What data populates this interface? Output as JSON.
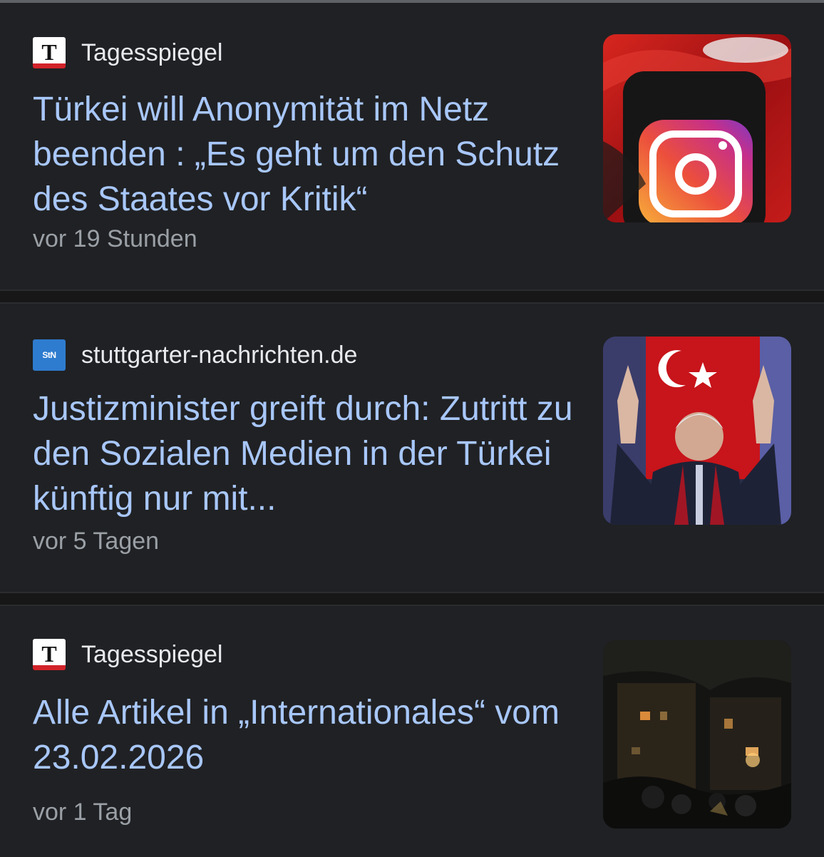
{
  "articles": [
    {
      "source": "Tagesspiegel",
      "favicon": "tagesspiegel-icon",
      "favicon_text": "T",
      "headline": "Türkei will Anonymität im Netz beenden : „Es geht um den Schutz des Staates vor Kritik“",
      "time": "vor 19 Stunden",
      "thumbnail": "instagram-logo-on-phone-with-turkish-flag-icon"
    },
    {
      "source": "stuttgarter-nachrichten.de",
      "favicon": "stuttgarter-nachrichten-icon",
      "favicon_text": "StN",
      "headline": "Justizminister greift durch: Zutritt zu den Sozialen Medien in der Türkei künftig nur mit...",
      "time": "vor 5 Tagen",
      "thumbnail": "politician-raising-hands-before-turkish-flag-icon"
    },
    {
      "source": "Tagesspiegel",
      "favicon": "tagesspiegel-icon",
      "favicon_text": "T",
      "headline": "Alle Artikel in „Internationales“ vom 23.02.2026",
      "time": "vor 1 Tag",
      "thumbnail": "night-street-scene-icon"
    }
  ],
  "colors": {
    "background": "#202124",
    "headline": "#a8c7fa",
    "source": "#e8eaed",
    "time": "#9aa0a6"
  }
}
